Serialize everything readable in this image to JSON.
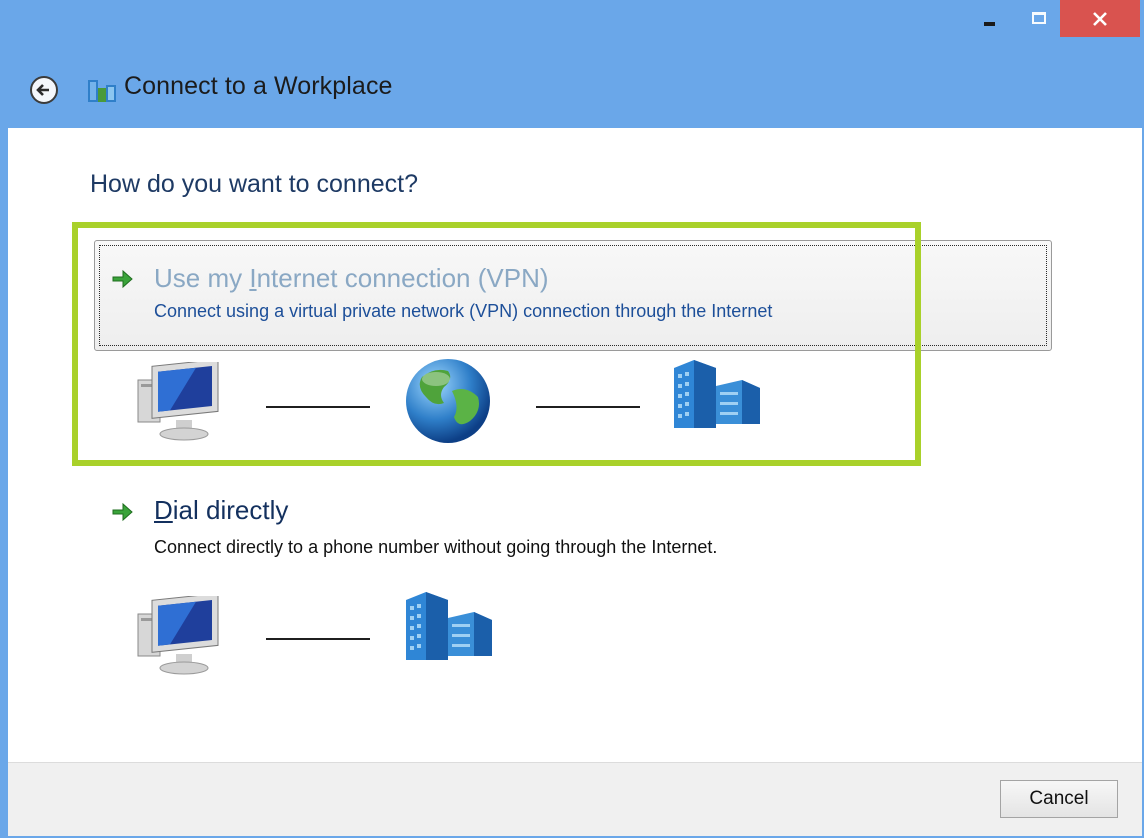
{
  "window": {
    "title": "Connect to a Workplace",
    "close_glyph": "✕"
  },
  "page": {
    "heading": "How do you want to connect?"
  },
  "options": {
    "vpn": {
      "title_prefix": "Use my ",
      "title_accel": "I",
      "title_rest": "nternet connection (VPN)",
      "description": "Connect using a virtual private network (VPN) connection through the Internet"
    },
    "dial": {
      "title_accel": "D",
      "title_rest": "ial directly",
      "description": "Connect directly to a phone number without going through the Internet."
    }
  },
  "footer": {
    "cancel_label": "Cancel"
  },
  "colors": {
    "titlebar": "#6aa7e9",
    "highlight": "#a9d12a",
    "close": "#d9534f",
    "heading": "#1e3a64"
  },
  "icons": [
    "back-arrow-icon",
    "workplace-network-icon",
    "green-arrow-icon",
    "computer-icon",
    "globe-icon",
    "office-building-icon"
  ]
}
